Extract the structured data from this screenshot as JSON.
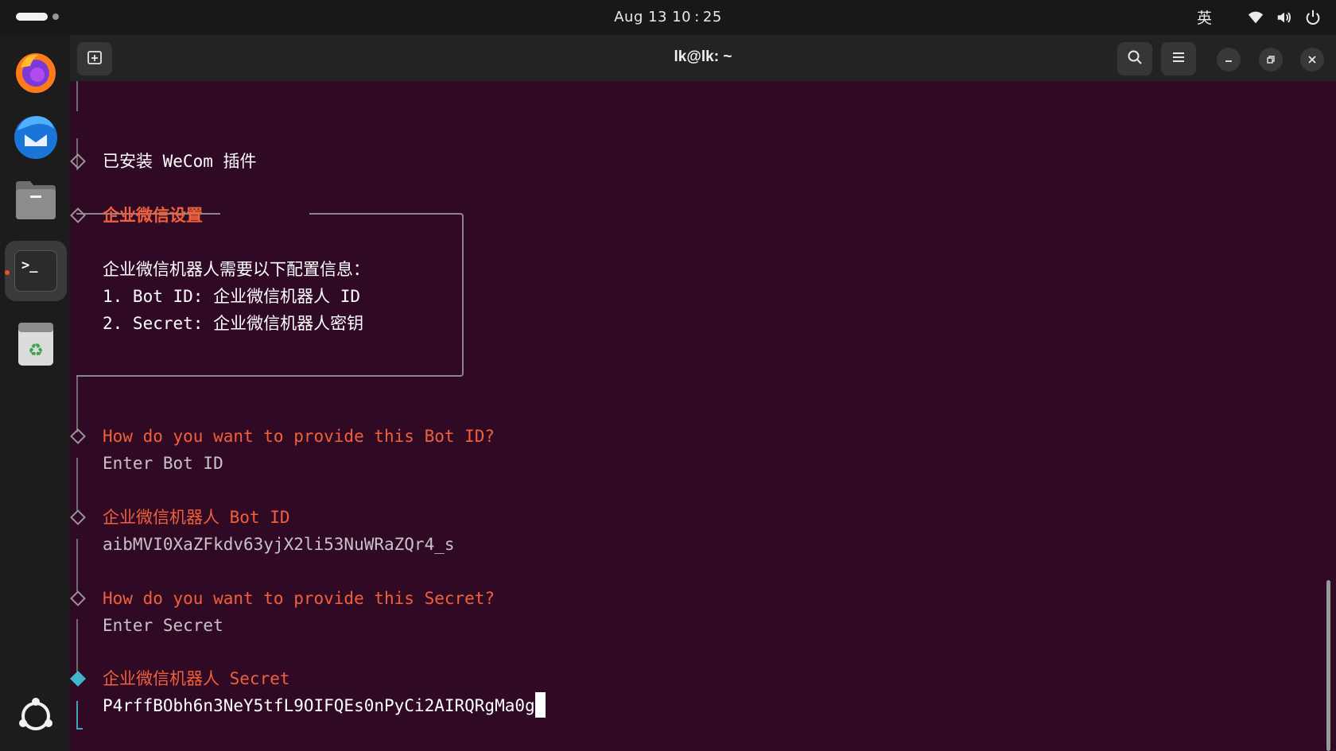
{
  "top_bar": {
    "clock": "Aug 13  10 : 25",
    "input_method": "英",
    "icons": [
      "activities-indicator",
      "wifi-icon",
      "volume-icon",
      "power-icon"
    ]
  },
  "dock": {
    "apps": [
      {
        "name": "firefox",
        "icon": "firefox-icon"
      },
      {
        "name": "thunderbird",
        "icon": "thunderbird-icon"
      },
      {
        "name": "files",
        "icon": "files-icon"
      },
      {
        "name": "terminal",
        "icon": "terminal-icon",
        "active": true
      },
      {
        "name": "trash",
        "icon": "trash-icon"
      },
      {
        "name": "show-apps",
        "icon": "ubuntu-logo-icon"
      }
    ],
    "terminal_glyph": ">_"
  },
  "window": {
    "title": "lk@lk: ~",
    "buttons": [
      "new-tab-icon",
      "search-icon",
      "menu-icon",
      "minimize-icon",
      "restore-icon",
      "close-icon"
    ]
  },
  "terminal": {
    "installed": "已安装 WeCom 插件",
    "setup_heading": "企业微信设置",
    "setup_lines": [
      "企业微信机器人需要以下配置信息：",
      "1. Bot ID: 企业微信机器人 ID",
      "2. Secret: 企业微信机器人密钥"
    ],
    "q_bot_id": "How do you want to provide this Bot ID?",
    "a_bot_id": "Enter Bot ID",
    "bot_id_label": "企业微信机器人 Bot ID",
    "bot_id_value": "aibMVI0XaZFkdv63yjX2li53NuWRaZQr4_s",
    "q_secret": "How do you want to provide this Secret?",
    "a_secret": "Enter Secret",
    "secret_label": "企业微信机器人 Secret",
    "secret_value": "P4rffBObh6n3NeY5tfL9OIFQEs0nPyCi2AIRQRgMa0g"
  },
  "colors": {
    "terminal_bg": "#300a24",
    "prompt_orange": "#f0603a",
    "active_cyan": "#3fb6cc"
  }
}
